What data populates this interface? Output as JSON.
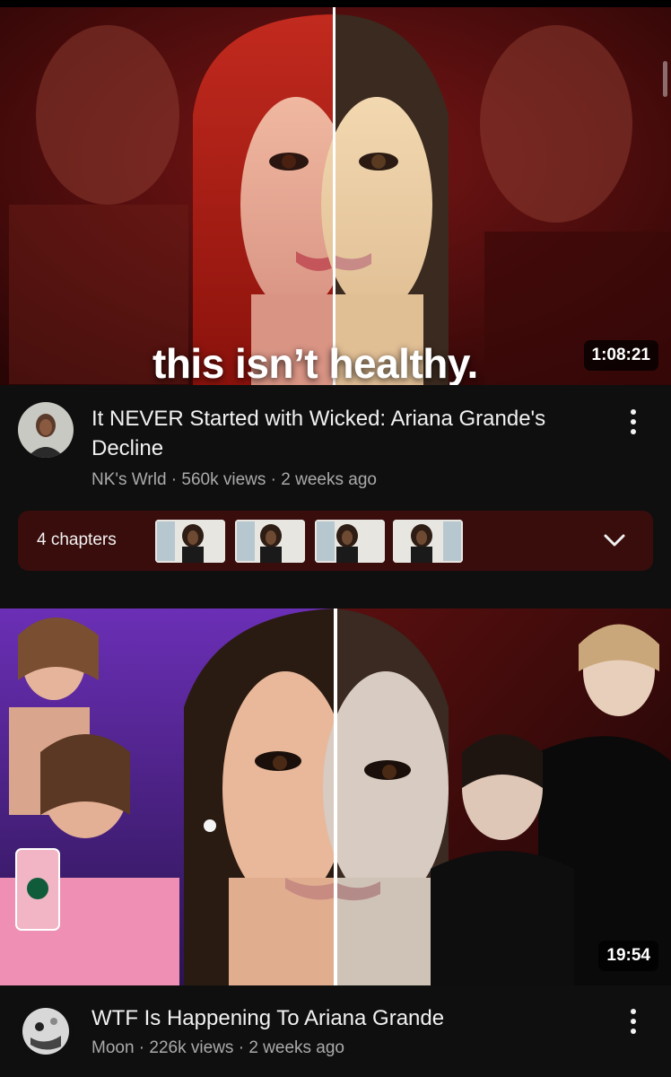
{
  "videos": [
    {
      "thumbnail_text": "this isn’t healthy.",
      "duration": "1:08:21",
      "title": "It NEVER Started with Wicked: Ariana Grande's Decline",
      "channel": "NK's Wrld",
      "views": "560k views",
      "age": "2 weeks ago",
      "chapters": {
        "label": "4 chapters",
        "count": 4
      }
    },
    {
      "duration": "19:54",
      "title": "WTF Is Happening To Ariana Grande",
      "channel": "Moon",
      "views": "226k views",
      "age": "2 weeks ago"
    }
  ],
  "colors": {
    "background": "#0f0f0f",
    "text_primary": "#f1f1f1",
    "text_secondary": "#aaaaaa",
    "chapters_bg": "#3a0d0d"
  },
  "icons": {
    "more": "more-vertical-icon",
    "expand": "chevron-down-icon"
  }
}
